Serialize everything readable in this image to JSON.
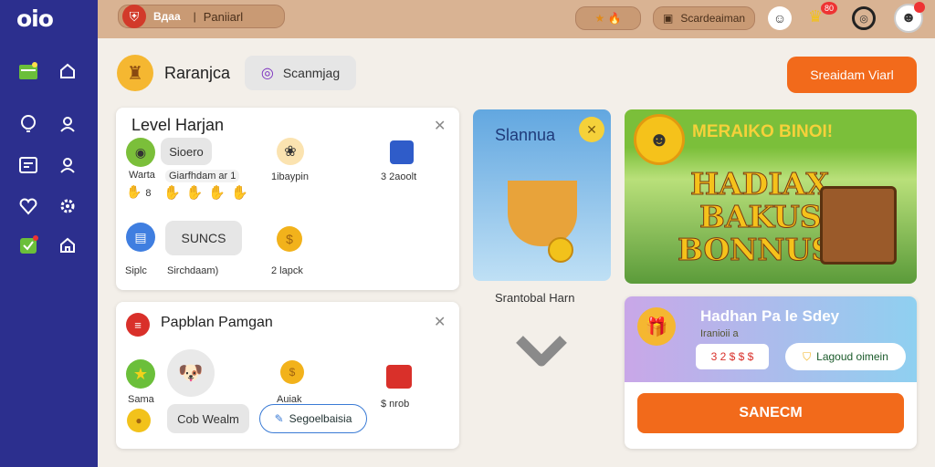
{
  "app": {
    "logo": "oio",
    "title": "Bдaa",
    "subtitle": "Paniiarl"
  },
  "topbar": {
    "pill_label": "Scardeaiman",
    "notif_count": "80",
    "stars": "★ 🔥"
  },
  "sidebar": {
    "items": [
      {
        "icon": "calendar-icon"
      },
      {
        "icon": "home-icon"
      },
      {
        "icon": "bulb-icon"
      },
      {
        "icon": "user-icon"
      },
      {
        "icon": "list-icon"
      },
      {
        "icon": "profile-icon"
      },
      {
        "icon": "heart-icon"
      },
      {
        "icon": "gear-icon"
      },
      {
        "icon": "check-icon"
      },
      {
        "icon": "house-icon"
      }
    ]
  },
  "header": {
    "title": "Raranjca",
    "search_label": "Scanmjag",
    "cta_label": "Sreaidam Viarl"
  },
  "level_card": {
    "title": "Level Harjan",
    "btn1": "Sioero",
    "btn2": "SUNCS",
    "sub1": "Warta",
    "sub2": "8",
    "label1": "Giarfhdam ar",
    "label2": "1",
    "item1": "1ibaypin",
    "item2": "3 2aoolt",
    "label3": "Siplc",
    "label4": "Sirchdaam)",
    "item3": "2 lapck"
  },
  "plan_card": {
    "title": "Papblan Pamgan",
    "label1": "Sama",
    "btn1": "Cob Wealm",
    "btn2": "Segoelbaisia",
    "item1": "Auiak",
    "item2": "$ nrob"
  },
  "promo": {
    "title": "Slannua",
    "caption": "Srantobal Harn"
  },
  "banner": {
    "title": "MERAIKO BINOI!",
    "line1": "HADIAX",
    "line2": "BAKUS",
    "line3": "BONNUS"
  },
  "offer": {
    "title": "Hadhan Pa le Sdey",
    "sub": "Iranioii a",
    "price": "3 2 $ $ $",
    "btn": "Lagoud oimein",
    "cta": "SANECM"
  },
  "colors": {
    "sidebar": "#2c2f8e",
    "topbar": "#d9b393",
    "orange": "#f26a1b",
    "green": "#6bbf3a",
    "blue": "#62a7e0"
  }
}
